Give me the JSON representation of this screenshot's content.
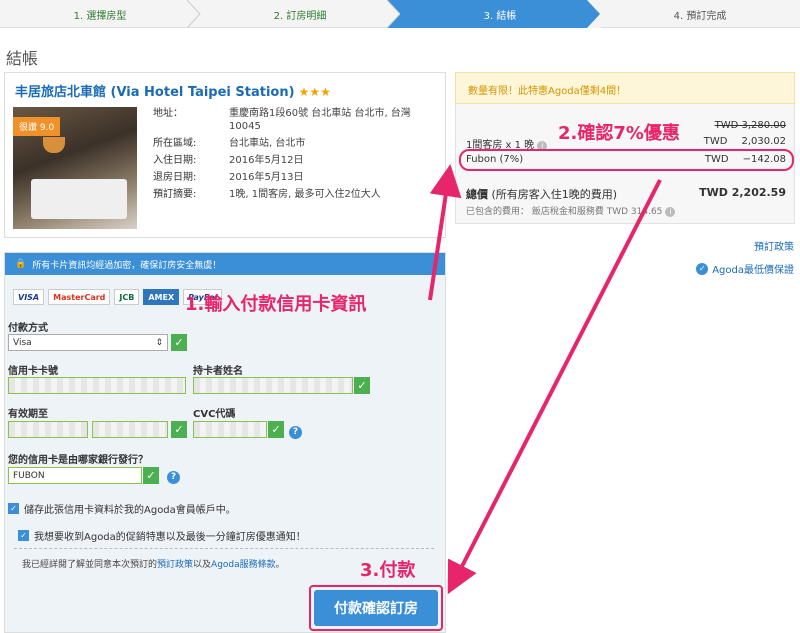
{
  "steps": [
    "1. 選擇房型",
    "2. 訂房明細",
    "3. 結帳",
    "4. 預訂完成"
  ],
  "page_title": "結帳",
  "hotel": {
    "name": "丰居旅店北車館 (Via Hotel Taipei Station)",
    "stars": "★★★",
    "rating_badge": "很讚 9.0",
    "info": [
      {
        "label": "地址：",
        "value": "重慶南路1段60號 台北車站 台北市, 台灣 10045"
      },
      {
        "label": "所在區域:",
        "value": "台北車站, 台北市"
      },
      {
        "label": "入住日期:",
        "value": "2016年5月12日"
      },
      {
        "label": "退房日期:",
        "value": "2016年5月13日"
      },
      {
        "label": "預訂摘要:",
        "value": "1晚, 1間客房, 最多可入住2位大人"
      }
    ]
  },
  "promo_text": "數量有限！此特惠Agoda僅剩4間！",
  "summary": {
    "original_price": "TWD 3,280.00",
    "room_label": "1間客房 x 1 晚",
    "room_cur": "TWD",
    "room_price": "2,030.02",
    "discount_label": "Fubon (7%)",
    "discount_cur": "TWD",
    "discount_value": "−142.08",
    "total_label": "總價",
    "total_note": "(所有房客入住1晚的費用)",
    "total_value": "TWD  2,202.59",
    "included_text": "已包含的費用： 飯店稅金和服務費 TWD 314.65"
  },
  "policy_link": "預訂政策",
  "guarantee_text": "Agoda最低價保證",
  "payment": {
    "secure_text": "所有卡片資訊均經過加密，確保訂房安全無虞！",
    "card_logos": [
      "VISA",
      "MasterCard",
      "JCB",
      "AMEX",
      "PayPal"
    ],
    "method_label": "付款方式",
    "method_value": "Visa",
    "card_number_label": "信用卡卡號",
    "holder_label": "持卡者姓名",
    "expiry_label": "有效期至",
    "cvc_label": "CVC代碼",
    "bank_label": "您的信用卡是由哪家銀行發行？",
    "bank_value": "FUBON",
    "save_card_text": "儲存此張信用卡資料於我的Agoda會員帳戶中。",
    "newsletter_text": "我想要收到Agoda的促銷特惠以及最後一分鐘訂房優惠通知！",
    "terms_prefix": "我已經詳閱了解並同意本次預訂的",
    "terms_link1": "預訂政策",
    "terms_mid": "以及",
    "terms_link2": "Agoda服務條款",
    "terms_suffix": "。",
    "pay_button": "付款確認訂房"
  },
  "annotations": {
    "a1": "1.輸入付款信用卡資訊",
    "a2": "2.確認7%優惠",
    "a3": "3.付款"
  },
  "colors": {
    "accent": "#3a8fd6",
    "annotation": "#e6256a",
    "promo": "#d69500",
    "valid": "#4caf50"
  }
}
